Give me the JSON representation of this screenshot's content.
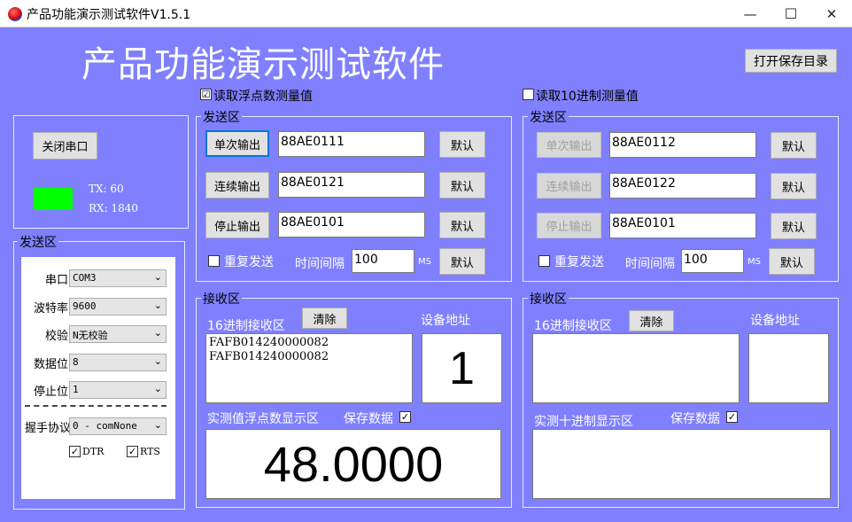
{
  "window": {
    "title": "产品功能演示测试软件V1.5.1",
    "min_glyph": "—",
    "max_glyph": "☐",
    "close_glyph": "✕"
  },
  "header": {
    "title": "产品功能演示测试软件",
    "open_dir_label": "打开保存目录"
  },
  "mode": {
    "float_label": "读取浮点数测量值",
    "float_checked": "☑",
    "dec_label": "读取10进制测量值",
    "dec_checked": "☐"
  },
  "serial": {
    "close_port_label": "关闭串口",
    "status_color": "#00ff00",
    "tx": "TX: 60",
    "rx": "RX: 1840",
    "group_label": "发送区",
    "port_label": "串口",
    "port_value": "COM3",
    "baud_label": "波特率",
    "baud_value": "9600",
    "parity_label": "校验",
    "parity_value": "N无校验",
    "databits_label": "数据位",
    "databits_value": "8",
    "stopbits_label": "停止位",
    "stopbits_value": "1",
    "handshake_label": "握手协议",
    "handshake_value": "0 - comNone",
    "dtr_label": "DTR",
    "rts_label": "RTS",
    "check_mark": "✓"
  },
  "left_send": {
    "group_label": "发送区",
    "single_label": "单次输出",
    "single_value": "88AE0111",
    "continuous_label": "连续输出",
    "continuous_value": "88AE0121",
    "stop_label": "停止输出",
    "stop_value": "88AE0101",
    "default_label": "默认",
    "repeat_label": "重复发送",
    "interval_label": "时间间隔",
    "interval_value": "100",
    "ms_label": "MS"
  },
  "right_send": {
    "group_label": "发送区",
    "single_label": "单次输出",
    "single_value": "88AE0112",
    "continuous_label": "连续输出",
    "continuous_value": "88AE0122",
    "stop_label": "停止输出",
    "stop_value": "88AE0101",
    "default_label": "默认",
    "repeat_label": "重复发送",
    "interval_label": "时间间隔",
    "interval_value": "100",
    "ms_label": "MS"
  },
  "left_recv": {
    "group_label": "接收区",
    "hex_label": "16进制接收区",
    "clear_label": "清除",
    "addr_label": "设备地址",
    "hex_lines": [
      "FAFB014240000082",
      "FAFB014240000082"
    ],
    "addr_value": "1",
    "float_label": "实测值浮点数显示区",
    "save_label": "保存数据",
    "save_mark": "✓",
    "float_value": "48.0000"
  },
  "right_recv": {
    "group_label": "接收区",
    "hex_label": "16进制接收区",
    "clear_label": "清除",
    "addr_label": "设备地址",
    "dec_label": "实测十进制显示区",
    "save_label": "保存数据",
    "save_mark": "✓"
  }
}
